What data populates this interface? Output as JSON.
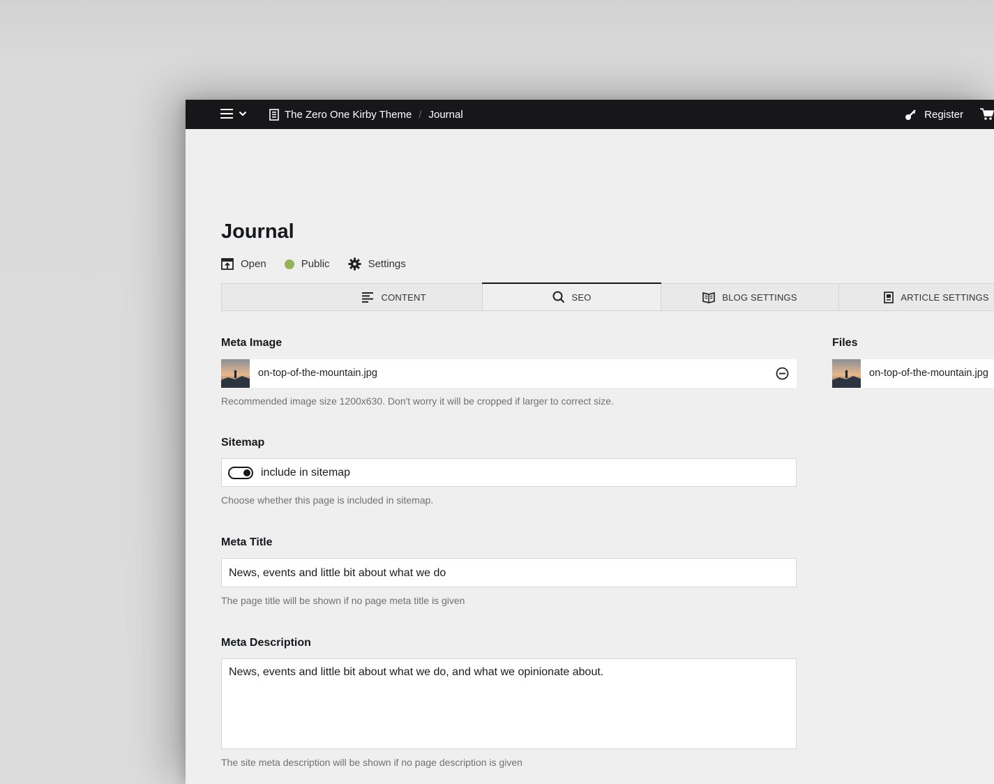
{
  "topbar": {
    "menu_icon": "hamburger-icon",
    "dropdown_icon": "chevron-down-icon",
    "site_icon": "page-icon",
    "breadcrumb": [
      "The Zero One Kirby Theme",
      "Journal"
    ],
    "breadcrumb_separator": "/",
    "register_label": "Register",
    "register_icon": "key-icon",
    "cart_icon": "cart-icon"
  },
  "page": {
    "title": "Journal",
    "actions": [
      {
        "label": "Open",
        "icon": "open-icon"
      },
      {
        "label": "Public",
        "icon": "status-dot-icon",
        "color": "#96b15a"
      },
      {
        "label": "Settings",
        "icon": "gear-icon"
      }
    ]
  },
  "tabs": [
    {
      "label": "CONTENT",
      "icon": "text-left-icon",
      "active": false
    },
    {
      "label": "SEO",
      "icon": "search-icon",
      "active": true
    },
    {
      "label": "BLOG SETTINGS",
      "icon": "book-icon",
      "active": false
    },
    {
      "label": "ARTICLE SETTINGS",
      "icon": "document-icon",
      "active": false
    }
  ],
  "meta_image": {
    "label": "Meta Image",
    "file": "on-top-of-the-mountain.jpg",
    "remove_icon": "remove-circle-icon",
    "help": "Recommended image size 1200x630. Don't worry it will be cropped if larger to correct size."
  },
  "files": {
    "label": "Files",
    "items": [
      "on-top-of-the-mountain.jpg"
    ]
  },
  "sitemap": {
    "label": "Sitemap",
    "toggle_text": "include in sitemap",
    "toggle_on": true,
    "help": "Choose whether this page is included in sitemap."
  },
  "meta_title": {
    "label": "Meta Title",
    "value": "News, events and little bit about what we do",
    "help": "The page title will be shown if no page meta title is given"
  },
  "meta_description": {
    "label": "Meta Description",
    "value": "News, events and little bit about what we do, and what we opinionate about.",
    "help": "The site meta description will be shown if no page description is given"
  },
  "colors": {
    "topbar": "#17171a",
    "background": "#efefef",
    "public_status": "#96b15a"
  }
}
